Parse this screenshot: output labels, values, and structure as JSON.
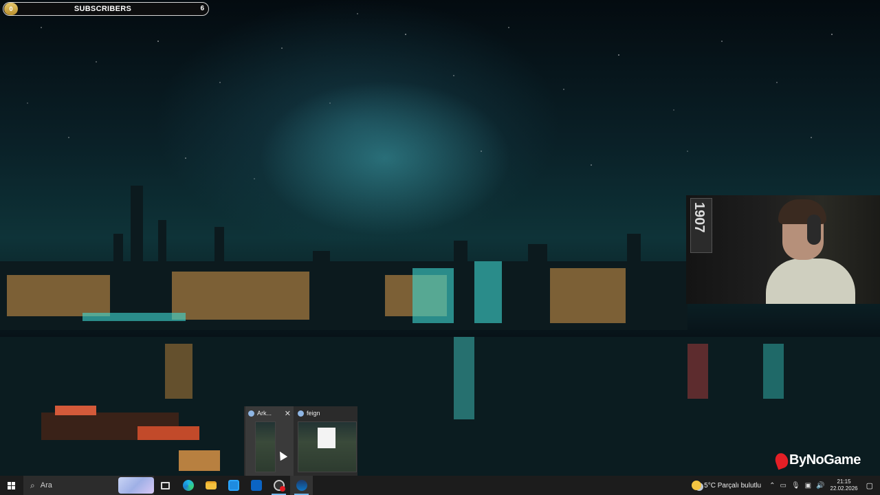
{
  "overlay": {
    "badge_value": "0",
    "subscribers_label": "SUBSCRIBERS",
    "subscribers_count": "6"
  },
  "webcam": {
    "tag_text": "1907"
  },
  "task_preview": {
    "windows": [
      {
        "title": "Ark...",
        "icon": "steam-icon"
      },
      {
        "title": "feign",
        "icon": "steam-icon"
      }
    ]
  },
  "watermark": {
    "text": "ByNoGame"
  },
  "taskbar": {
    "search_placeholder": "Ara",
    "apps": [
      "task-view-icon",
      "edge-icon",
      "file-explorer-icon",
      "store-icon",
      "mail-icon",
      "obs-icon",
      "steam-icon"
    ],
    "weather_text": "5°C  Parçalı bulutlu",
    "time": "21:15",
    "date": "22.02.2026"
  },
  "colors": {
    "accent": "#76b9ed",
    "taskbar_bg": "#1c1c1c",
    "brand_red": "#e31f26"
  }
}
